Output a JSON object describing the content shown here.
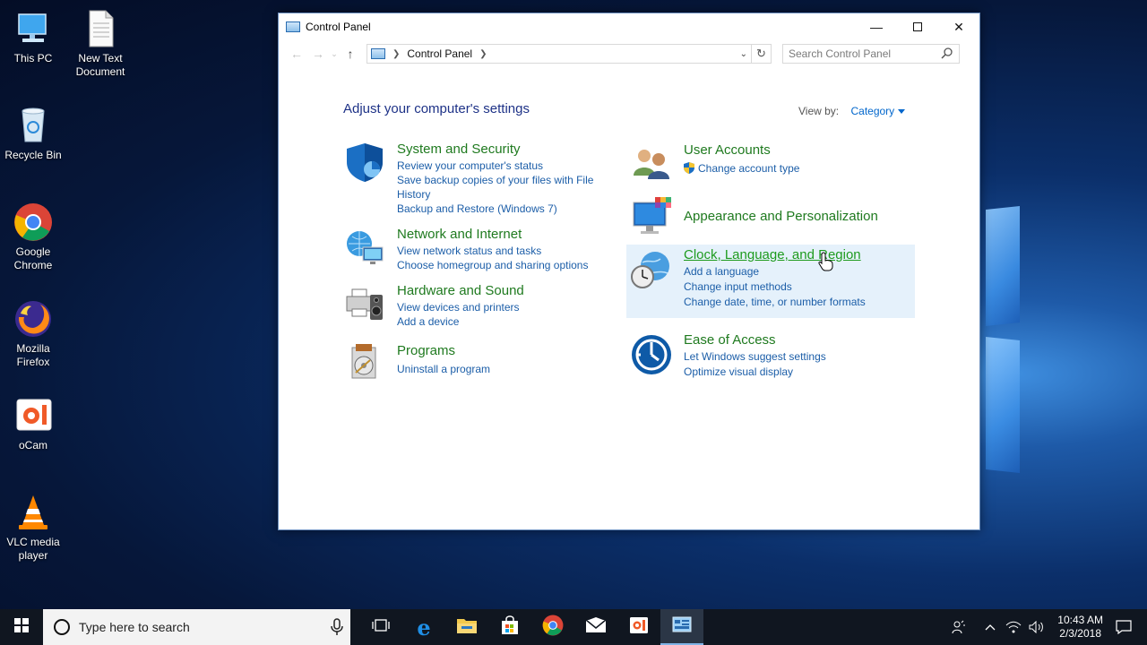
{
  "desktop": {
    "icons": [
      {
        "label": "This PC"
      },
      {
        "label": "New Text Document"
      },
      {
        "label": "Recycle Bin"
      },
      {
        "label": "Google Chrome"
      },
      {
        "label": "Mozilla Firefox"
      },
      {
        "label": "oCam"
      },
      {
        "label": "VLC media player"
      }
    ]
  },
  "window": {
    "title": "Control Panel",
    "address": {
      "crumb": "Control Panel"
    },
    "search": {
      "placeholder": "Search Control Panel"
    },
    "heading": "Adjust your computer's settings",
    "view_by": {
      "label": "View by:",
      "value": "Category"
    },
    "categories": [
      {
        "title": "System and Security",
        "links": [
          "Review your computer's status",
          "Save backup copies of your files with File History",
          "Backup and Restore (Windows 7)"
        ]
      },
      {
        "title": "Network and Internet",
        "links": [
          "View network status and tasks",
          "Choose homegroup and sharing options"
        ]
      },
      {
        "title": "Hardware and Sound",
        "links": [
          "View devices and printers",
          "Add a device"
        ]
      },
      {
        "title": "Programs",
        "links": [
          "Uninstall a program"
        ]
      },
      {
        "title": "User Accounts",
        "links": [
          "Change account type"
        ]
      },
      {
        "title": "Appearance and Personalization",
        "links": []
      },
      {
        "title": "Clock, Language, and Region",
        "links": [
          "Add a language",
          "Change input methods",
          "Change date, time, or number formats"
        ]
      },
      {
        "title": "Ease of Access",
        "links": [
          "Let Windows suggest settings",
          "Optimize visual display"
        ]
      }
    ]
  },
  "taskbar": {
    "search_placeholder": "Type here to search",
    "clock": {
      "time": "10:43 AM",
      "date": "2/3/2018"
    }
  }
}
